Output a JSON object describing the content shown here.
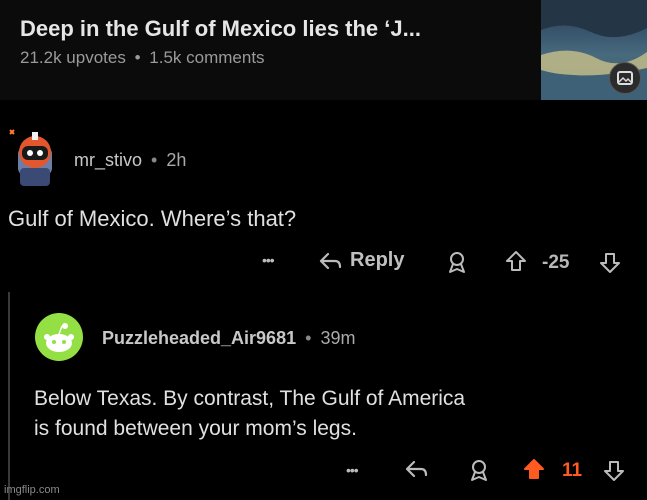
{
  "post": {
    "title": "Deep in the Gulf of Mexico lies the ‘J...",
    "upvotes": "21.2k upvotes",
    "separator": "•",
    "comments": "1.5k comments"
  },
  "comment1": {
    "username": "mr_stivo",
    "separator": "•",
    "time": "2h",
    "body": "Gulf of Mexico. Where’s that?",
    "more": "•••",
    "reply_label": "Reply",
    "score": "-25"
  },
  "comment2": {
    "username": "Puzzleheaded_Air9681",
    "separator": "•",
    "time": "39m",
    "body_line1": "Below Texas. By contrast, The Gulf of America",
    "body_line2": "is found between your mom’s legs.",
    "more": "•••",
    "score": "11"
  },
  "watermark": "imgflip.com",
  "colors": {
    "upvote_active": "#ff5a1f"
  },
  "icons": [
    "reply-arrow-icon",
    "award-icon",
    "upvote-icon",
    "downvote-icon",
    "image-gallery-icon",
    "more-icon"
  ]
}
